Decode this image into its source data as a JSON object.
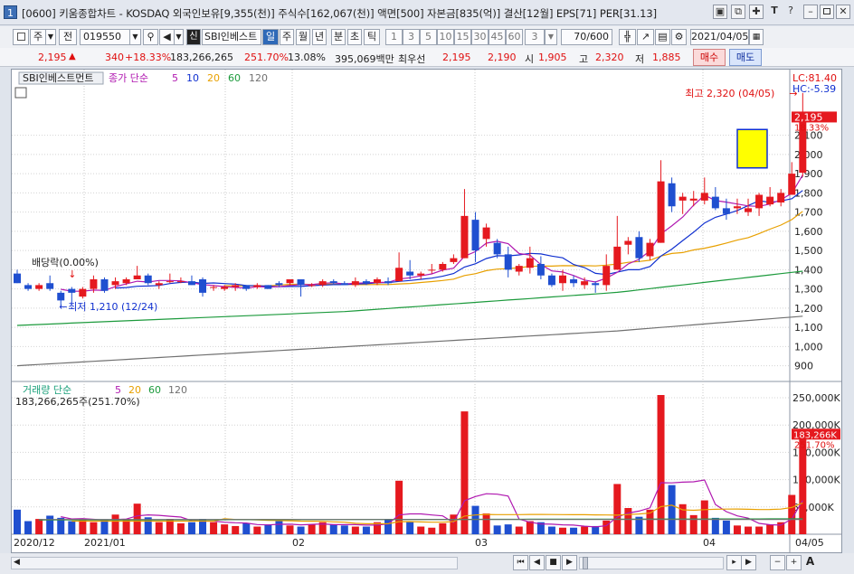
{
  "window": {
    "app_num": "1",
    "title": "[0600] 키움종합차트 - KOSDAQ 외국인보유[9,355(천)] 주식수[162,067(천)] 액면[500] 자본금[835(억)] 결산[12월] EPS[71] PER[31.13]",
    "ctrl": [
      "▣",
      "⧉",
      "✚",
      "T",
      "?",
      "–",
      "✕"
    ]
  },
  "toolbar": {
    "mode": "주",
    "prev": "전",
    "code": "019550",
    "name": "SBI인베스트",
    "period_active": "일",
    "periods": [
      "주",
      "월",
      "년",
      "분",
      "초",
      "틱"
    ],
    "nums": [
      "1",
      "3",
      "5",
      "10",
      "15",
      "30",
      "45",
      "60"
    ],
    "sel": "3",
    "count": "70/600",
    "date": "2021/04/05"
  },
  "quote": {
    "price": "2,195",
    "change": "340",
    "rate": "+18.33%",
    "volume": "183,266,265",
    "vol_rate": "251.70%",
    "turnover": "13.08%",
    "amount": "395,069백만",
    "pref_label": "최우선",
    "ask": "2,195",
    "bid": "2,190",
    "open_label": "시",
    "open": "1,905",
    "high_label": "고",
    "high": "2,320",
    "low_label": "저",
    "low": "1,885",
    "buy": "매수",
    "sell": "매도"
  },
  "price_panel": {
    "title": "SBI인베스트먼트",
    "ma_label": "종가 단순",
    "ma_periods": [
      "5",
      "10",
      "20",
      "60",
      "120"
    ],
    "ma_colors": [
      "#b018b0",
      "#1030d0",
      "#e8a000",
      "#1c9a3c",
      "#707070"
    ],
    "lc": "LC:81.40",
    "hc": "HC:-5.39",
    "cur_price": "2,195",
    "cur_rate": "18.33%",
    "high_note": "최고 2,320 (04/05)",
    "low_note": "최저 1,210 (12/24)",
    "div_note": "배당락(0.00%)",
    "axis": [
      "2,100",
      "2,000",
      "1,900",
      "1,800",
      "1,700",
      "1,600",
      "1,500",
      "1,400",
      "1,300",
      "1,200",
      "1,100",
      "1,000",
      "900"
    ]
  },
  "volume_panel": {
    "title": "거래량 단순",
    "ma_periods": [
      "5",
      "20",
      "60",
      "120"
    ],
    "ma_colors": [
      "#b018b0",
      "#e8a000",
      "#1c9a3c",
      "#707070"
    ],
    "value": "183,266,265주(251.70%)",
    "cur": "183,266K",
    "cur_rate": "251.70%",
    "axis": [
      "250,000K",
      "200,000K",
      "150,000K",
      "100,000K",
      "50,000K"
    ]
  },
  "x_axis": {
    "labels": [
      "2020/12",
      "2021/01",
      "02",
      "03",
      "04"
    ],
    "last": "04/05"
  },
  "chart_data": {
    "type": "candlestick",
    "ylim": [
      800,
      2400
    ],
    "candles": [
      [
        1380,
        1400,
        1330,
        1330
      ],
      [
        1320,
        1330,
        1290,
        1300
      ],
      [
        1300,
        1330,
        1290,
        1320
      ],
      [
        1330,
        1370,
        1290,
        1300
      ],
      [
        1280,
        1290,
        1210,
        1240
      ],
      [
        1300,
        1310,
        1230,
        1280
      ],
      [
        1260,
        1310,
        1250,
        1300
      ],
      [
        1300,
        1370,
        1280,
        1350
      ],
      [
        1350,
        1360,
        1280,
        1290
      ],
      [
        1320,
        1360,
        1300,
        1340
      ],
      [
        1330,
        1360,
        1320,
        1350
      ],
      [
        1350,
        1420,
        1350,
        1370
      ],
      [
        1370,
        1380,
        1320,
        1330
      ],
      [
        1320,
        1340,
        1300,
        1330
      ],
      [
        1340,
        1380,
        1330,
        1340
      ],
      [
        1340,
        1360,
        1330,
        1340
      ],
      [
        1340,
        1370,
        1320,
        1320
      ],
      [
        1350,
        1360,
        1260,
        1280
      ],
      [
        1310,
        1320,
        1290,
        1310
      ],
      [
        1300,
        1320,
        1290,
        1310
      ],
      [
        1310,
        1330,
        1290,
        1320
      ],
      [
        1320,
        1320,
        1290,
        1300
      ],
      [
        1310,
        1330,
        1300,
        1320
      ],
      [
        1320,
        1320,
        1300,
        1300
      ],
      [
        1330,
        1340,
        1310,
        1320
      ],
      [
        1330,
        1350,
        1320,
        1350
      ],
      [
        1350,
        1350,
        1260,
        1320
      ],
      [
        1320,
        1330,
        1310,
        1320
      ],
      [
        1320,
        1350,
        1310,
        1340
      ],
      [
        1340,
        1350,
        1320,
        1330
      ],
      [
        1330,
        1340,
        1320,
        1320
      ],
      [
        1320,
        1360,
        1310,
        1340
      ],
      [
        1340,
        1350,
        1320,
        1330
      ],
      [
        1330,
        1360,
        1320,
        1350
      ],
      [
        1340,
        1360,
        1320,
        1330
      ],
      [
        1340,
        1490,
        1340,
        1410
      ],
      [
        1390,
        1450,
        1350,
        1370
      ],
      [
        1370,
        1390,
        1350,
        1380
      ],
      [
        1400,
        1430,
        1380,
        1400
      ],
      [
        1400,
        1440,
        1390,
        1430
      ],
      [
        1440,
        1480,
        1430,
        1460
      ],
      [
        1460,
        1820,
        1460,
        1680
      ],
      [
        1660,
        1700,
        1440,
        1500
      ],
      [
        1560,
        1640,
        1520,
        1620
      ],
      [
        1540,
        1560,
        1460,
        1480
      ],
      [
        1480,
        1520,
        1360,
        1400
      ],
      [
        1390,
        1430,
        1370,
        1420
      ],
      [
        1410,
        1520,
        1380,
        1460
      ],
      [
        1430,
        1470,
        1350,
        1370
      ],
      [
        1370,
        1380,
        1310,
        1320
      ],
      [
        1330,
        1400,
        1290,
        1370
      ],
      [
        1350,
        1370,
        1310,
        1330
      ],
      [
        1320,
        1360,
        1300,
        1340
      ],
      [
        1330,
        1340,
        1280,
        1320
      ],
      [
        1320,
        1480,
        1290,
        1420
      ],
      [
        1400,
        1680,
        1400,
        1520
      ],
      [
        1530,
        1570,
        1480,
        1550
      ],
      [
        1570,
        1600,
        1440,
        1460
      ],
      [
        1470,
        1560,
        1450,
        1540
      ],
      [
        1540,
        1970,
        1540,
        1860
      ],
      [
        1850,
        1880,
        1700,
        1730
      ],
      [
        1760,
        1800,
        1690,
        1780
      ],
      [
        1760,
        1810,
        1730,
        1770
      ],
      [
        1760,
        1880,
        1740,
        1800
      ],
      [
        1780,
        1830,
        1710,
        1720
      ],
      [
        1720,
        1770,
        1660,
        1690
      ],
      [
        1720,
        1770,
        1690,
        1730
      ],
      [
        1700,
        1770,
        1680,
        1720
      ],
      [
        1720,
        1800,
        1680,
        1790
      ],
      [
        1740,
        1830,
        1730,
        1780
      ],
      [
        1750,
        1820,
        1730,
        1800
      ],
      [
        1790,
        1960,
        1790,
        1900
      ],
      [
        1905,
        2320,
        1885,
        2195
      ]
    ],
    "volume_k": [
      45,
      24,
      28,
      34,
      30,
      24,
      27,
      22,
      26,
      36,
      28,
      56,
      31,
      22,
      28,
      20,
      22,
      28,
      22,
      18,
      15,
      20,
      14,
      18,
      24,
      16,
      14,
      18,
      22,
      18,
      16,
      14,
      14,
      22,
      28,
      98,
      24,
      14,
      12,
      20,
      36,
      225,
      52,
      38,
      16,
      18,
      14,
      24,
      22,
      14,
      12,
      12,
      14,
      15,
      25,
      92,
      48,
      32,
      45,
      255,
      90,
      55,
      35,
      62,
      30,
      25,
      16,
      14,
      14,
      18,
      22,
      72,
      183
    ]
  }
}
